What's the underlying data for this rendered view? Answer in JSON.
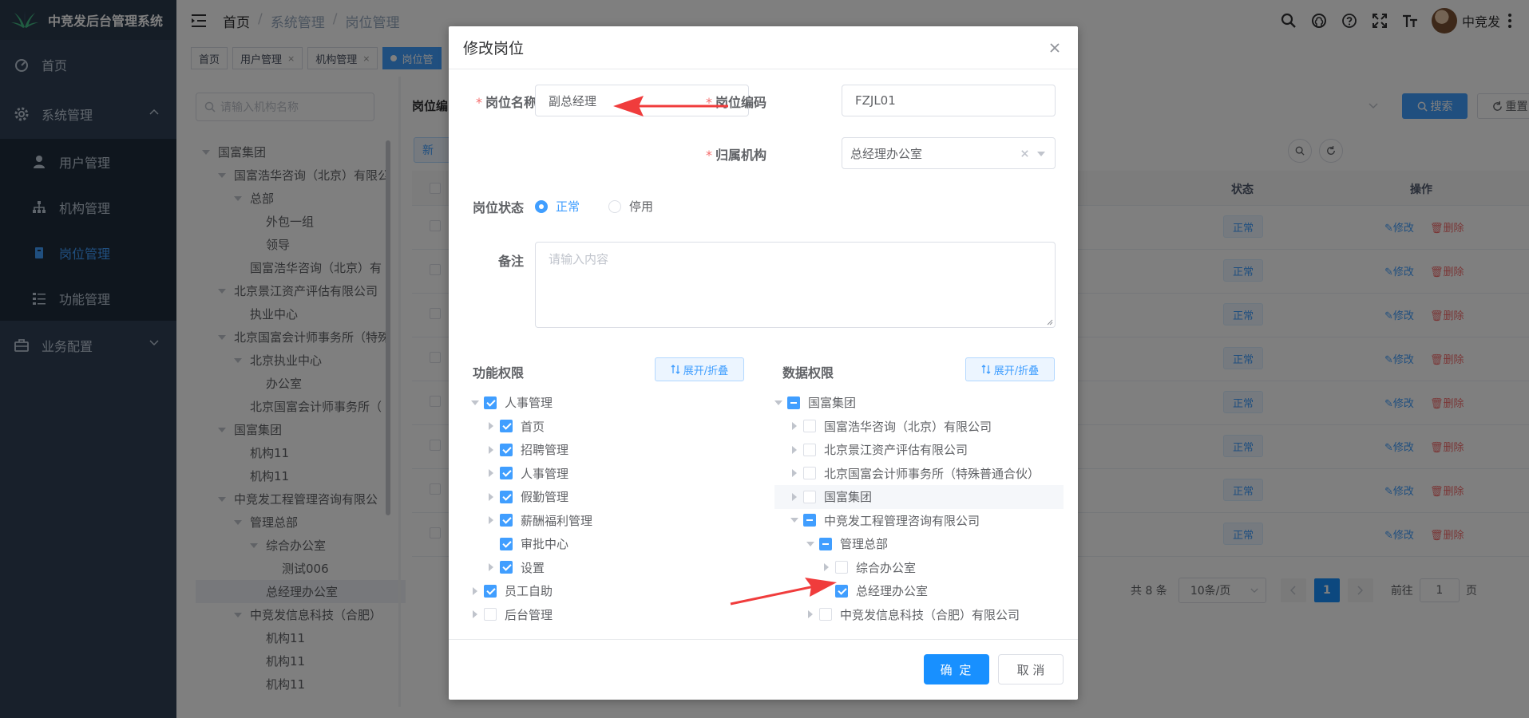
{
  "app": {
    "title": "中竞发后台管理系统"
  },
  "sidebar": {
    "home": "首页",
    "system": "系统管理",
    "sub_items": [
      {
        "label": "用户管理",
        "icon": "user-icon"
      },
      {
        "label": "机构管理",
        "icon": "org-icon"
      },
      {
        "label": "岗位管理",
        "icon": "post-icon"
      },
      {
        "label": "功能管理",
        "icon": "list-icon"
      }
    ],
    "business": "业务配置"
  },
  "navbar": {
    "breadcrumb": [
      "首页",
      "系统管理",
      "岗位管理"
    ],
    "username": "中竞发"
  },
  "tags": [
    {
      "label": "首页",
      "closable": false
    },
    {
      "label": "用户管理",
      "closable": true
    },
    {
      "label": "机构管理",
      "closable": true
    },
    {
      "label": "岗位管",
      "closable": false,
      "active": true
    }
  ],
  "content": {
    "tree_search_placeholder": "请输入机构名称",
    "org_tree": [
      {
        "label": "国富集团",
        "level": 0,
        "expand": true
      },
      {
        "label": "国富浩华咨询（北京）有限公",
        "level": 1,
        "expand": true
      },
      {
        "label": "总部",
        "level": 2,
        "expand": true
      },
      {
        "label": "外包一组",
        "level": 3,
        "expand": false
      },
      {
        "label": "领导",
        "level": 3,
        "expand": false
      },
      {
        "label": "国富浩华咨询（北京）有",
        "level": 2,
        "expand": false
      },
      {
        "label": "北京景江资产评估有限公司",
        "level": 1,
        "expand": true
      },
      {
        "label": "执业中心",
        "level": 2,
        "expand": false
      },
      {
        "label": "北京国富会计师事务所（特殊",
        "level": 1,
        "expand": true
      },
      {
        "label": "北京执业中心",
        "level": 2,
        "expand": true
      },
      {
        "label": "办公室",
        "level": 3,
        "expand": false
      },
      {
        "label": "北京国富会计师事务所（",
        "level": 2,
        "expand": false
      },
      {
        "label": "国富集团",
        "level": 1,
        "expand": true
      },
      {
        "label": "机构11",
        "level": 2,
        "expand": false
      },
      {
        "label": "机构11",
        "level": 2,
        "expand": false
      },
      {
        "label": "中竞发工程管理咨询有限公",
        "level": 1,
        "expand": true
      },
      {
        "label": "管理总部",
        "level": 2,
        "expand": true
      },
      {
        "label": "综合办公室",
        "level": 3,
        "expand": true
      },
      {
        "label": "测试006",
        "level": 4,
        "expand": false
      },
      {
        "label": "总经理办公室",
        "level": 3,
        "expand": false,
        "selected": true
      },
      {
        "label": "中竞发信息科技（合肥）",
        "level": 2,
        "expand": true
      },
      {
        "label": "机构11",
        "level": 3,
        "expand": false
      },
      {
        "label": "机构11",
        "level": 3,
        "expand": false
      },
      {
        "label": "机构11",
        "level": 3,
        "expand": false
      }
    ],
    "panel_label": "岗位编",
    "search_btn": "搜索",
    "reset_btn": "重置",
    "add_btn": "新",
    "col_status": "状态",
    "col_ops": "操作",
    "rows": [
      {
        "status": "正常",
        "edit": "修改",
        "del": "删除"
      },
      {
        "status": "正常",
        "edit": "修改",
        "del": "删除"
      },
      {
        "status": "正常",
        "edit": "修改",
        "del": "删除"
      },
      {
        "status": "正常",
        "edit": "修改",
        "del": "删除"
      },
      {
        "status": "正常",
        "edit": "修改",
        "del": "删除"
      },
      {
        "status": "正常",
        "edit": "修改",
        "del": "删除"
      },
      {
        "status": "正常",
        "edit": "修改",
        "del": "删除"
      },
      {
        "status": "正常",
        "edit": "修改",
        "del": "删除"
      }
    ],
    "pager": {
      "total": "共 8 条",
      "page_size": "10条/页",
      "current": "1",
      "goto": "前往",
      "goto_value": "1",
      "page_suffix": "页"
    }
  },
  "dialog": {
    "title": "修改岗位",
    "post_name_label": "岗位名称",
    "post_name_value": "副总经理",
    "post_code_label": "岗位编码",
    "post_code_value": "FZJL01",
    "org_label": "归属机构",
    "org_value": "总经理办公室",
    "status_label": "岗位状态",
    "status_normal": "正常",
    "status_disabled": "停用",
    "remark_label": "备注",
    "remark_placeholder": "请输入内容",
    "func_label": "功能权限",
    "data_label": "数据权限",
    "expand_btn": "展开/折叠",
    "func_tree": [
      {
        "label": "人事管理",
        "level": 0,
        "exp": "down",
        "check": "checked"
      },
      {
        "label": "首页",
        "level": 1,
        "exp": "right",
        "check": "checked"
      },
      {
        "label": "招聘管理",
        "level": 1,
        "exp": "right",
        "check": "checked"
      },
      {
        "label": "人事管理",
        "level": 1,
        "exp": "right",
        "check": "checked"
      },
      {
        "label": "假勤管理",
        "level": 1,
        "exp": "right",
        "check": "checked"
      },
      {
        "label": "薪酬福利管理",
        "level": 1,
        "exp": "right",
        "check": "checked"
      },
      {
        "label": "审批中心",
        "level": 1,
        "exp": "none",
        "check": "checked"
      },
      {
        "label": "设置",
        "level": 1,
        "exp": "right",
        "check": "checked"
      },
      {
        "label": "员工自助",
        "level": 0,
        "exp": "right",
        "check": "checked"
      },
      {
        "label": "后台管理",
        "level": 0,
        "exp": "right",
        "check": "none"
      }
    ],
    "data_tree": [
      {
        "label": "国富集团",
        "level": 0,
        "exp": "down",
        "check": "half"
      },
      {
        "label": "国富浩华咨询（北京）有限公司",
        "level": 1,
        "exp": "right",
        "check": "none"
      },
      {
        "label": "北京景江资产评估有限公司",
        "level": 1,
        "exp": "right",
        "check": "none"
      },
      {
        "label": "北京国富会计师事务所（特殊普通合伙）",
        "level": 1,
        "exp": "right",
        "check": "none"
      },
      {
        "label": "国富集团",
        "level": 1,
        "exp": "right",
        "check": "none",
        "hover": true
      },
      {
        "label": "中竞发工程管理咨询有限公司",
        "level": 1,
        "exp": "down",
        "check": "half"
      },
      {
        "label": "管理总部",
        "level": 2,
        "exp": "down",
        "check": "half"
      },
      {
        "label": "综合办公室",
        "level": 3,
        "exp": "right",
        "check": "none"
      },
      {
        "label": "总经理办公室",
        "level": 3,
        "exp": "none",
        "check": "checked"
      },
      {
        "label": "中竞发信息科技（合肥）有限公司",
        "level": 2,
        "exp": "right",
        "check": "none"
      }
    ],
    "ok_btn": "确 定",
    "cancel_btn": "取 消"
  },
  "colors": {
    "primary": "#409eff",
    "sidebar": "#304156",
    "danger": "#f56c6c",
    "annotation_arrow": "#f03c3c"
  }
}
